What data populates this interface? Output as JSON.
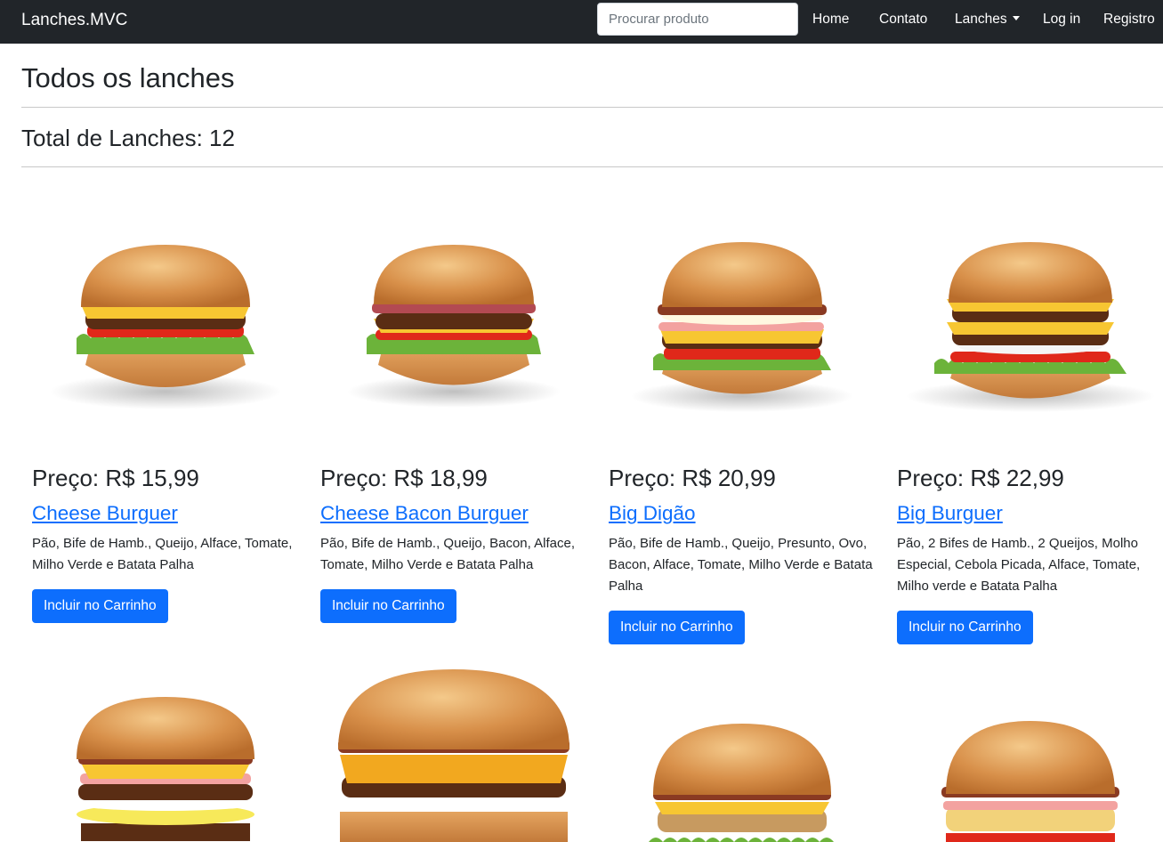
{
  "navbar": {
    "brand": "Lanches.MVC",
    "search_placeholder": "Procurar produto",
    "links": {
      "home": "Home",
      "contato": "Contato",
      "lanches": "Lanches",
      "login": "Log in",
      "registro": "Registro"
    }
  },
  "page": {
    "title": "Todos os lanches",
    "total": "Total de Lanches: 12"
  },
  "products": [
    {
      "price": "Preço: R$ 15,99",
      "name": "Cheese Burguer",
      "description": "Pão, Bife de Hamb., Queijo, Alface, Tomate, Milho Verde e Batata Palha",
      "button": "Incluir no Carrinho"
    },
    {
      "price": "Preço: R$ 18,99",
      "name": "Cheese Bacon Burguer",
      "description": "Pão, Bife de Hamb., Queijo, Bacon, Alface, Tomate, Milho Verde e Batata Palha",
      "button": "Incluir no Carrinho"
    },
    {
      "price": "Preço: R$ 20,99",
      "name": "Big Digão",
      "description": "Pão, Bife de Hamb., Queijo, Presunto, Ovo, Bacon, Alface, Tomate, Milho Verde e Batata Palha",
      "button": "Incluir no Carrinho"
    },
    {
      "price": "Preço: R$ 22,99",
      "name": "Big Burguer",
      "description": "Pão, 2 Bifes de Hamb., 2 Queijos, Molho Especial, Cebola Picada, Alface, Tomate, Milho verde e Batata Palha",
      "button": "Incluir no Carrinho"
    }
  ],
  "colors": {
    "navbar": "#212529",
    "link": "#0d6efd",
    "button": "#0d6efd"
  }
}
